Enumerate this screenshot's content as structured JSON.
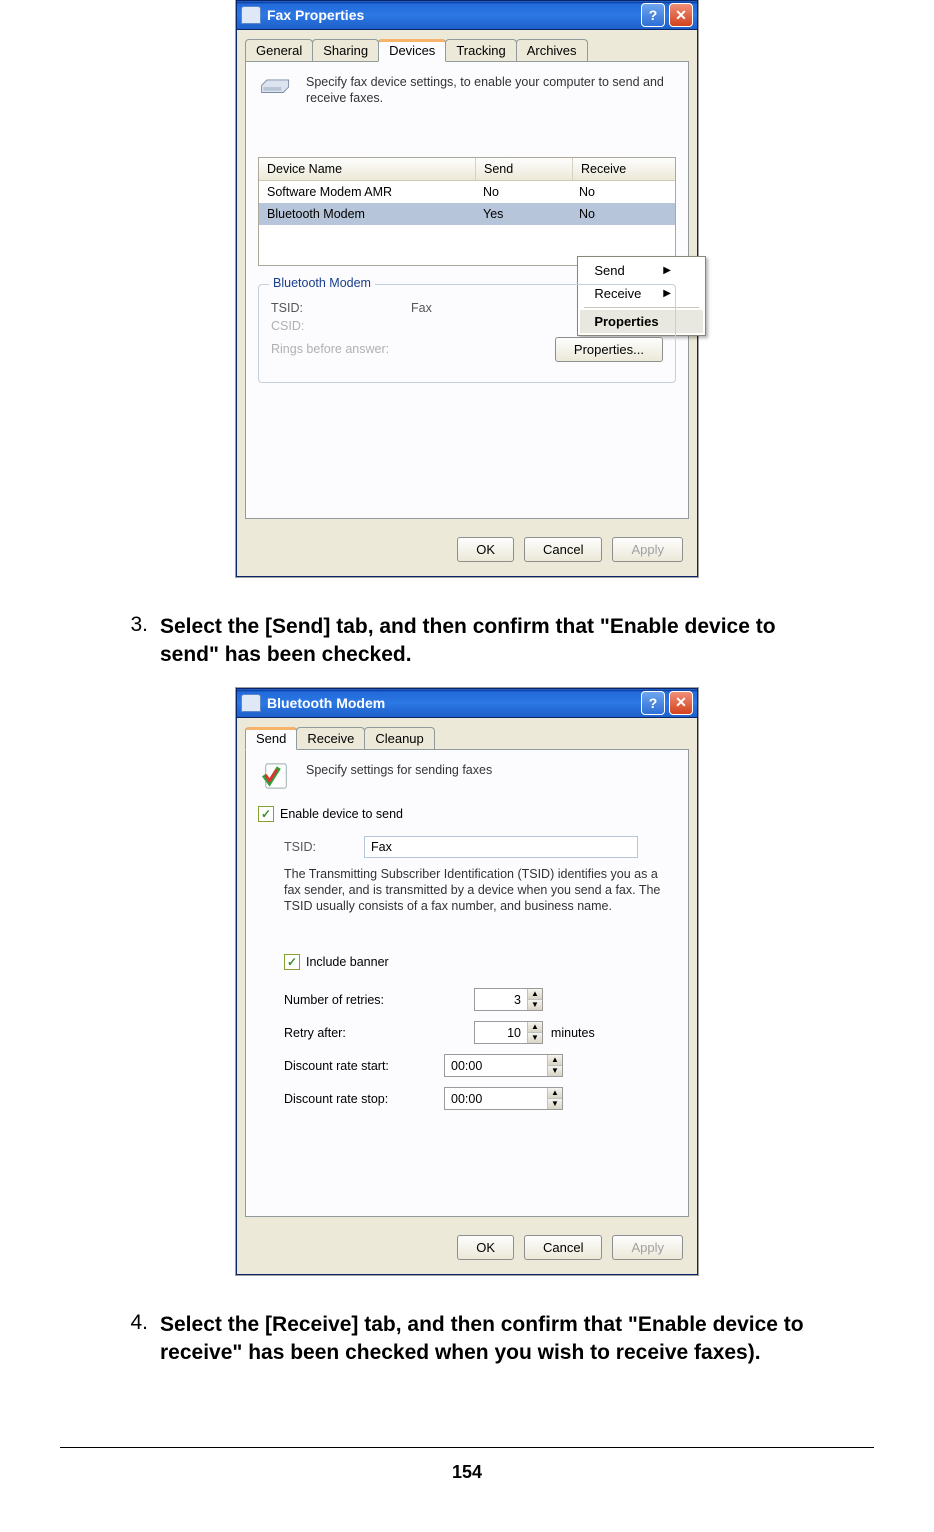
{
  "dialog1": {
    "title": "Fax Properties",
    "tabs": [
      "General",
      "Sharing",
      "Devices",
      "Tracking",
      "Archives"
    ],
    "active_tab": 2,
    "info": "Specify fax device settings, to enable your computer to send and receive faxes.",
    "table": {
      "headers": [
        "Device Name",
        "Send",
        "Receive"
      ],
      "rows": [
        {
          "name": "Software Modem AMR",
          "send": "No",
          "receive": "No",
          "selected": false
        },
        {
          "name": "Bluetooth Modem",
          "send": "Yes",
          "receive": "No",
          "selected": true
        }
      ]
    },
    "context_menu": {
      "items": [
        {
          "label": "Send",
          "submenu": true
        },
        {
          "label": "Receive",
          "submenu": true
        }
      ],
      "final": "Properties"
    },
    "group": {
      "legend": "Bluetooth Modem",
      "tsid_label": "TSID:",
      "tsid_value": "Fax",
      "csid_label": "CSID:",
      "rings_label": "Rings before answer:",
      "props_btn": "Properties..."
    },
    "buttons": {
      "ok": "OK",
      "cancel": "Cancel",
      "apply": "Apply"
    }
  },
  "step3": {
    "num": "3.",
    "text": "Select the [Send] tab, and then confirm that \"Enable device to send\" has been checked."
  },
  "dialog2": {
    "title": "Bluetooth Modem",
    "tabs": [
      "Send",
      "Receive",
      "Cleanup"
    ],
    "active_tab": 0,
    "info": "Specify settings for sending faxes",
    "enable_label": "Enable device to send",
    "tsid_label": "TSID:",
    "tsid_value": "Fax",
    "tsid_desc": "The Transmitting Subscriber Identification (TSID) identifies you as a fax sender, and is transmitted by a device when you send a fax. The TSID usually consists of a fax number, and business name.",
    "include_banner": "Include banner",
    "retries_label": "Number of retries:",
    "retries_value": "3",
    "retry_after_label": "Retry after:",
    "retry_after_value": "10",
    "retry_after_unit": "minutes",
    "disc_start_label": "Discount rate start:",
    "disc_start_value": "00:00",
    "disc_stop_label": "Discount rate stop:",
    "disc_stop_value": "00:00",
    "buttons": {
      "ok": "OK",
      "cancel": "Cancel",
      "apply": "Apply"
    }
  },
  "step4": {
    "num": "4.",
    "text": "Select the [Receive] tab, and then confirm that \"Enable device to receive\" has been checked when you wish to receive faxes)."
  },
  "page_number": "154"
}
